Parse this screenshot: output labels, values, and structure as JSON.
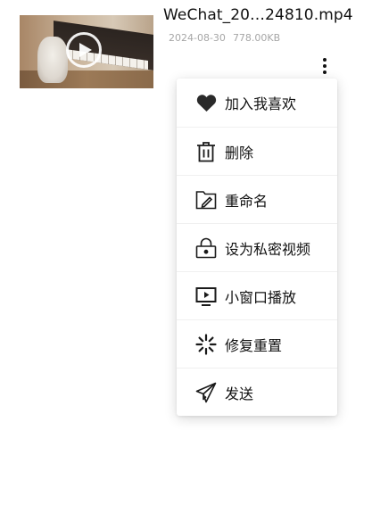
{
  "file": {
    "name": "WeChat_20…24810.mp4",
    "date": "2024-08-30",
    "size": "778.00KB",
    "thumbnail_icon": "play-icon"
  },
  "more_button": {
    "icon": "more-vertical-icon"
  },
  "menu": {
    "items": [
      {
        "label": "加入我喜欢",
        "icon": "heart-icon"
      },
      {
        "label": "删除",
        "icon": "trash-icon"
      },
      {
        "label": "重命名",
        "icon": "folder-edit-icon"
      },
      {
        "label": "设为私密视频",
        "icon": "lock-icon"
      },
      {
        "label": "小窗口播放",
        "icon": "picture-in-picture-icon"
      },
      {
        "label": "修复重置",
        "icon": "repair-reset-icon"
      },
      {
        "label": "发送",
        "icon": "send-icon"
      }
    ]
  }
}
